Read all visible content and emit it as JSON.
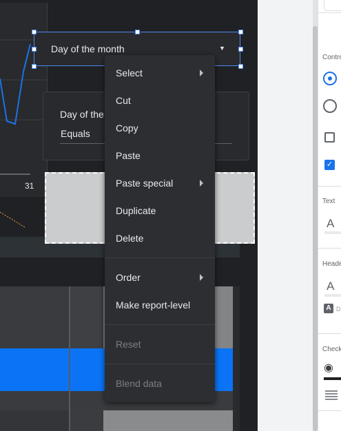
{
  "canvas": {
    "chart": {
      "x_tick_label": "31",
      "line_color": "#1a73e8"
    },
    "dropdown_control": {
      "label": "Day of the month"
    },
    "filter_card": {
      "label": "Day of the",
      "value": "Equals"
    },
    "table": {
      "highlight_color": "#0b74f6"
    }
  },
  "context_menu": {
    "groups": [
      [
        {
          "label": "Select",
          "submenu": true,
          "disabled": false
        },
        {
          "label": "Cut",
          "submenu": false,
          "disabled": false
        },
        {
          "label": "Copy",
          "submenu": false,
          "disabled": false
        },
        {
          "label": "Paste",
          "submenu": false,
          "disabled": false
        },
        {
          "label": "Paste special",
          "submenu": true,
          "disabled": false
        },
        {
          "label": "Duplicate",
          "submenu": false,
          "disabled": false
        },
        {
          "label": "Delete",
          "submenu": false,
          "disabled": false
        }
      ],
      [
        {
          "label": "Order",
          "submenu": true,
          "disabled": false
        },
        {
          "label": "Make report-level",
          "submenu": false,
          "disabled": false
        }
      ],
      [
        {
          "label": "Reset",
          "submenu": false,
          "disabled": true
        }
      ],
      [
        {
          "label": "Blend data",
          "submenu": false,
          "disabled": true
        }
      ]
    ],
    "items": {
      "select": "Select",
      "cut": "Cut",
      "copy": "Copy",
      "paste": "Paste",
      "paste_special": "Paste special",
      "duplicate": "Duplicate",
      "delete": "Delete",
      "order": "Order",
      "make_report_level": "Make report-level",
      "reset": "Reset",
      "blend_data": "Blend data"
    }
  },
  "properties_panel": {
    "sections": {
      "controls": "Contro",
      "text": "Text",
      "header": "Heade",
      "checkbox": "Check"
    },
    "text_icon_glyph": "A",
    "text_box_glyph": "A",
    "text_box_label": "D",
    "icons": [
      "radio-checked-icon",
      "radio-unchecked-icon",
      "checkbox-unchecked-icon",
      "checkbox-checked-icon",
      "fill-color-icon",
      "line-style-icon"
    ],
    "accent_color": "#1a73e8"
  }
}
